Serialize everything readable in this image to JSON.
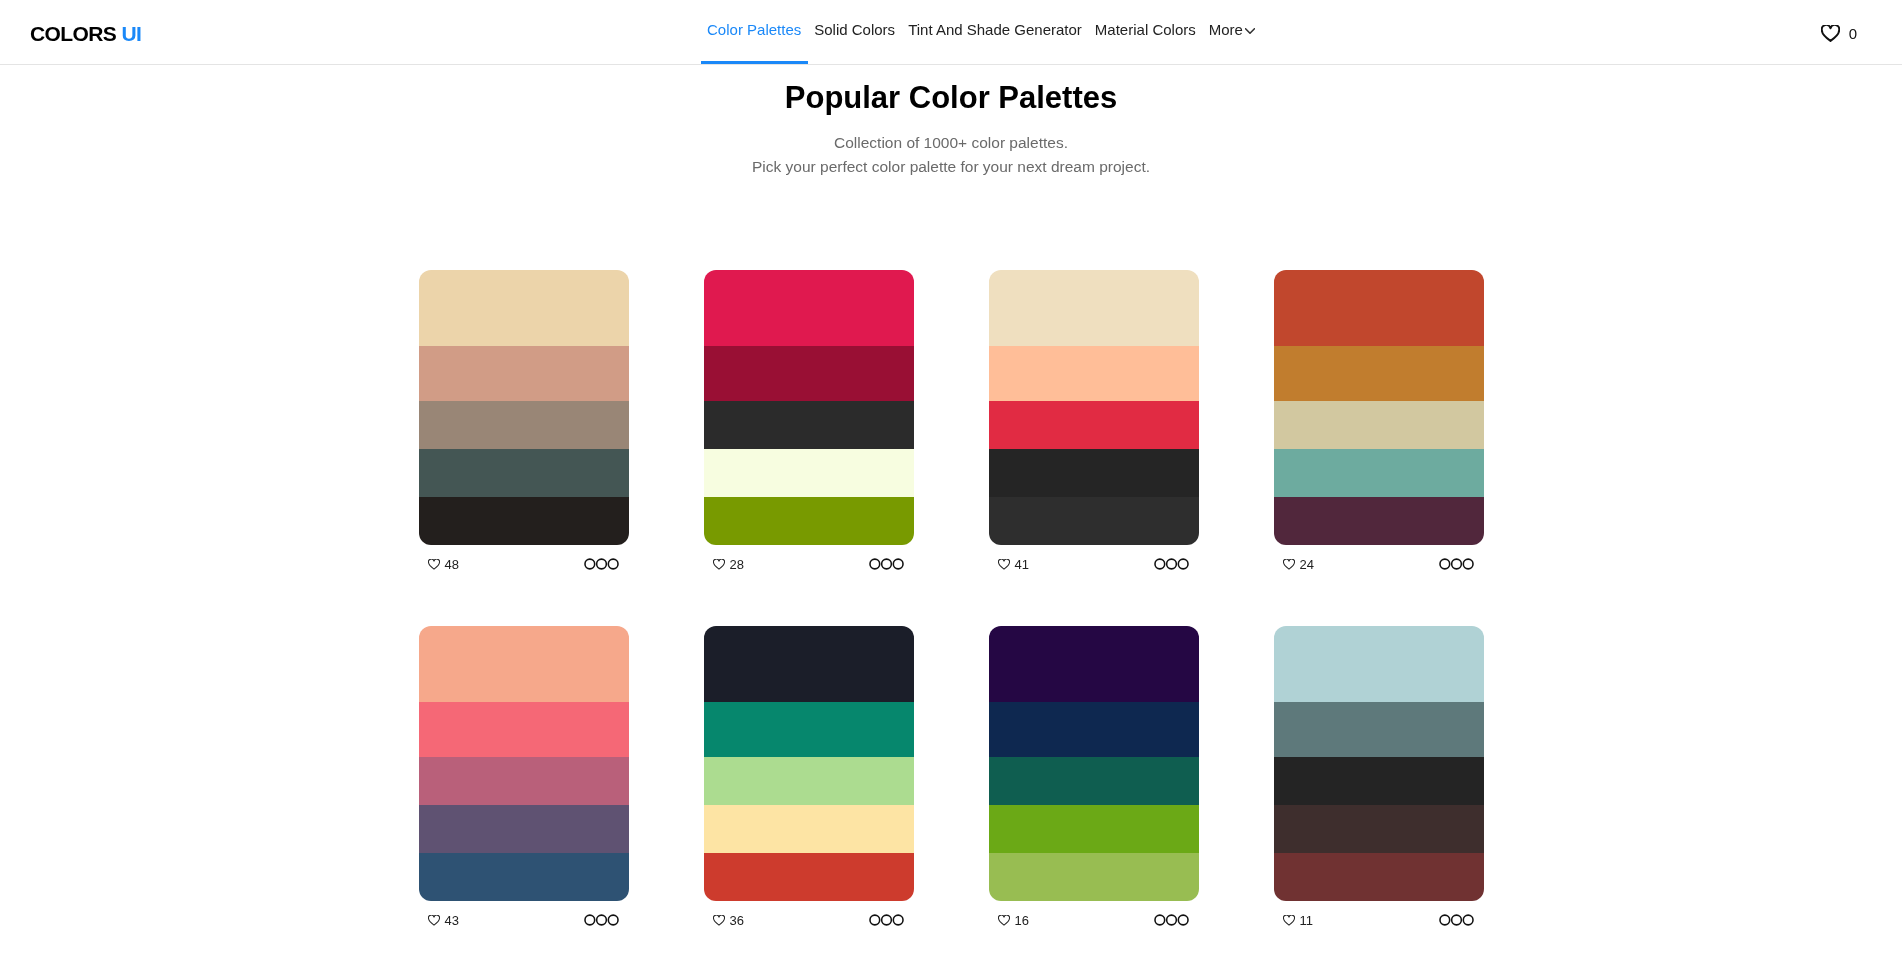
{
  "header": {
    "logo": {
      "text": "COLORS",
      "accent": "UI"
    },
    "nav": [
      {
        "label": "Color Palettes",
        "selected": true,
        "kind": "link"
      },
      {
        "label": "Solid Colors",
        "selected": false,
        "kind": "link"
      },
      {
        "label": "Tint And Shade Generator",
        "selected": false,
        "kind": "link"
      },
      {
        "label": "Material Colors",
        "selected": false,
        "kind": "link"
      },
      {
        "label": "More",
        "selected": false,
        "kind": "dropdown"
      }
    ],
    "favorites": {
      "count": "0"
    }
  },
  "hero": {
    "title": "Popular Color Palettes",
    "lines": [
      "Collection of 1000+ color palettes.",
      "Pick your perfect color palette for your next dream project."
    ]
  },
  "palettes": [
    {
      "swatches": [
        {
          "color": "#ecd4aa"
        },
        {
          "color": "#d19c86"
        },
        {
          "color": "#998676"
        },
        {
          "color": "#445654"
        },
        {
          "color": "#231f1d"
        }
      ],
      "likes": "48"
    },
    {
      "swatches": [
        {
          "color": "#e0194f"
        },
        {
          "color": "#990f34"
        },
        {
          "color": "#2b2b2b"
        },
        {
          "color": "#f7fde0"
        },
        {
          "color": "#789a00"
        }
      ],
      "likes": "28"
    },
    {
      "swatches": [
        {
          "color": "#efdfbf"
        },
        {
          "color": "#ffbe98"
        },
        {
          "color": "#e12b43"
        },
        {
          "color": "#252525"
        },
        {
          "color": "#2e2e2e"
        }
      ],
      "likes": "41"
    },
    {
      "swatches": [
        {
          "color": "#c1472d"
        },
        {
          "color": "#c17d2e"
        },
        {
          "color": "#d2c8a0"
        },
        {
          "color": "#6dab9f"
        },
        {
          "color": "#51273c"
        }
      ],
      "likes": "24"
    },
    {
      "swatches": [
        {
          "color": "#f6a88b"
        },
        {
          "color": "#f56876"
        },
        {
          "color": "#b9607a"
        },
        {
          "color": "#5f5272"
        },
        {
          "color": "#2e5273"
        }
      ],
      "likes": "43"
    },
    {
      "swatches": [
        {
          "color": "#1b1e29"
        },
        {
          "color": "#06876d"
        },
        {
          "color": "#acdc90"
        },
        {
          "color": "#fde4a4"
        },
        {
          "color": "#cd3b2d"
        }
      ],
      "likes": "36"
    },
    {
      "swatches": [
        {
          "color": "#250744"
        },
        {
          "color": "#0e2850"
        },
        {
          "color": "#0f5e50"
        },
        {
          "color": "#6ba916"
        },
        {
          "color": "#98bd52"
        }
      ],
      "likes": "16"
    },
    {
      "swatches": [
        {
          "color": "#b0d2d5"
        },
        {
          "color": "#5e797b"
        },
        {
          "color": "#242424"
        },
        {
          "color": "#3e2e2d"
        },
        {
          "color": "#703232"
        }
      ],
      "likes": "11"
    }
  ]
}
